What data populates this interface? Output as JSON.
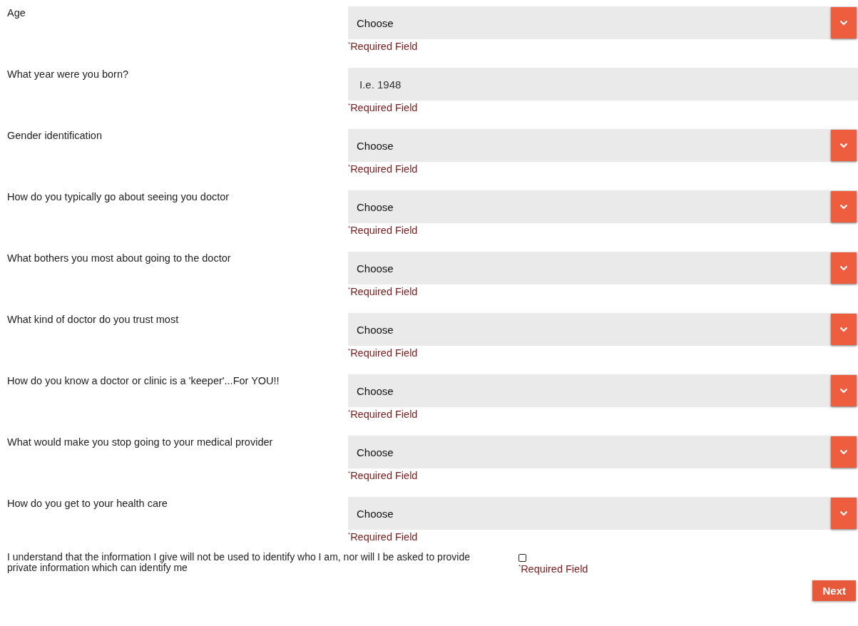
{
  "questions": [
    {
      "label": "Age",
      "kind": "select",
      "value": "Choose",
      "note": "$^{*}$Required Field"
    },
    {
      "label": "What year were you born?",
      "kind": "text",
      "placeholder": "I.e. 1948",
      "note": "$^{*}$Required Field"
    },
    {
      "label": "Gender identification",
      "kind": "select",
      "value": "Choose",
      "note": "$^{*}$Required Field"
    },
    {
      "label": "How do you typically go about seeing you doctor",
      "kind": "select",
      "value": "Choose",
      "note": "$^{*}$Required Field"
    },
    {
      "label": "What bothers you most about going to the doctor",
      "kind": "select",
      "value": "Choose",
      "note": "$^{*}$Required Field"
    },
    {
      "label": "What kind of doctor do you trust most",
      "kind": "select",
      "value": "Choose",
      "note": "$^{*}$Required Field"
    },
    {
      "label": "How do you know a doctor or clinic is a 'keeper'...For YOU!!",
      "kind": "select",
      "value": "Choose",
      "note": "$^{*}$Required Field"
    },
    {
      "label": "What would make you stop going to your medical provider",
      "kind": "select",
      "value": "Choose",
      "note": "$^{*}$Required Field"
    },
    {
      "label": "How do you get to your health care",
      "kind": "select",
      "value": "Choose",
      "note": "$^{*}$Required Field"
    }
  ],
  "consent": {
    "label": "I understand that the information I give will not be used to identify who I am, nor will I be asked to provide private information which can identify me",
    "checked": false,
    "note": "$^{*}$Required Field"
  },
  "next_button": "Next"
}
